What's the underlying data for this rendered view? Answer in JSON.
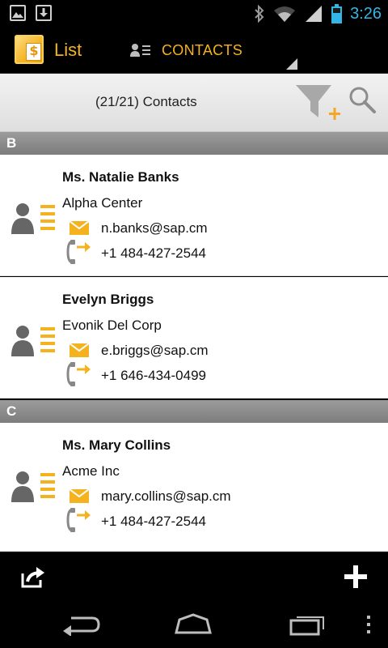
{
  "status_bar": {
    "time": "3:26",
    "icons": [
      "gallery-icon",
      "download-icon",
      "bluetooth-icon",
      "wifi-icon",
      "signal-icon",
      "battery-icon"
    ]
  },
  "action_bar": {
    "app_title": "List",
    "view_label": "CONTACTS",
    "accent_color": "#f5b21f"
  },
  "list_header": {
    "count_text": "(21/21) Contacts"
  },
  "sections": [
    {
      "letter": "B",
      "contacts": [
        {
          "name": "Ms. Natalie Banks",
          "company": "Alpha Center",
          "email": "n.banks@sap.cm",
          "phone": "+1 484-427-2544"
        },
        {
          "name": "Evelyn Briggs",
          "company": "Evonik Del Corp",
          "email": "e.briggs@sap.cm",
          "phone": "+1 646-434-0499"
        }
      ]
    },
    {
      "letter": "C",
      "contacts": [
        {
          "name": "Ms. Mary Collins",
          "company": "Acme Inc",
          "email": "mary.collins@sap.cm",
          "phone": "+1 484-427-2544"
        }
      ]
    }
  ],
  "bottom_bar": {
    "icons": [
      "share-icon",
      "add-icon"
    ]
  },
  "nav_bar": {
    "icons": [
      "back-icon",
      "home-icon",
      "recents-icon",
      "overflow-menu-icon"
    ]
  }
}
